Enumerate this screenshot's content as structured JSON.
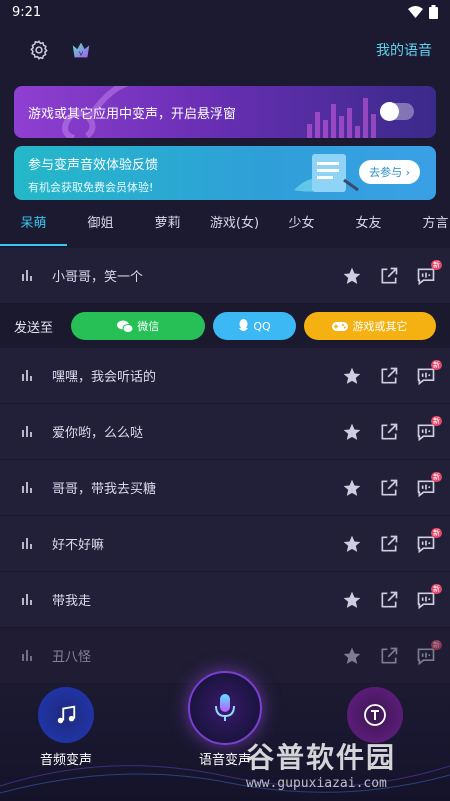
{
  "status": {
    "time": "9:21"
  },
  "header": {
    "my_voice_label": "我的语音"
  },
  "banner_float": {
    "text": "游戏或其它应用中变声，开启悬浮窗",
    "toggle_on": false
  },
  "banner_feedback": {
    "title": "参与变声音效体验反馈",
    "subtitle": "有机会获取免费会员体验!",
    "button_label": "去参与 ›"
  },
  "tabs": [
    {
      "label": "呆萌",
      "active": true
    },
    {
      "label": "御姐"
    },
    {
      "label": "萝莉"
    },
    {
      "label": "游戏(女)"
    },
    {
      "label": "少女"
    },
    {
      "label": "女友"
    },
    {
      "label": "方言"
    }
  ],
  "rows": [
    {
      "label": "小哥哥，笑一个"
    },
    {
      "label": "嘿嘿，我会听话的"
    },
    {
      "label": "爱你哟，么么哒"
    },
    {
      "label": "哥哥，带我去买糖"
    },
    {
      "label": "好不好嘛"
    },
    {
      "label": "带我走"
    },
    {
      "label": "丑八怪"
    }
  ],
  "send_to": {
    "label": "发送至",
    "wechat": "微信",
    "qq": "QQ",
    "other": "游戏或其它"
  },
  "badge": {
    "new": "新"
  },
  "bottom_nav": {
    "audio": "音频变声",
    "voice": "语音变声"
  },
  "watermark": {
    "title": "谷普软件园",
    "url": "www.gupuxiazai.com"
  },
  "colors": {
    "accent": "#36c8f0",
    "wechat": "#27c056",
    "qq": "#3cb8f5",
    "other": "#f5b112"
  }
}
